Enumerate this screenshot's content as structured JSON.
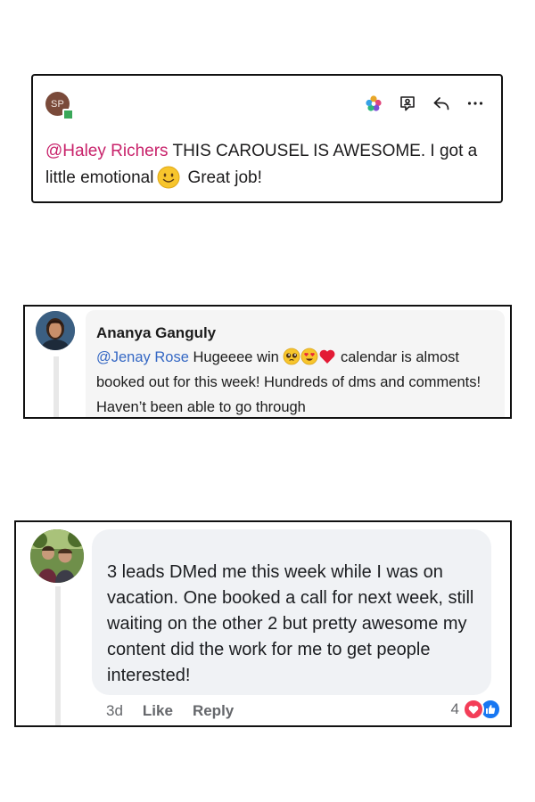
{
  "card1": {
    "avatar_initials": "SP",
    "mention": "@Haley Richers",
    "text_main": " THIS CAROUSEL IS AWESOME. I got a little emotional",
    "text_end": "Great job!",
    "actions": [
      "apps-icon",
      "assign-icon",
      "reply-icon",
      "more-icon"
    ],
    "mention_color": "#c8236b",
    "status_color": "#3aa859"
  },
  "card2": {
    "author": "Ananya Ganguly",
    "mention": "@Jenay Rose",
    "text_start": " Hugeeee win ",
    "text_rest": " calendar is almost booked out for this week! Hundreds of dms and comments! Haven’t been able to go through",
    "emojis": [
      "pleading-face-icon",
      "heart-eyes-icon",
      "red-heart-icon"
    ],
    "mention_color": "#3568c4"
  },
  "card3": {
    "text": "3 leads DMed me this week while I was on vacation. One booked a call for next week, still waiting on the other 2 but pretty awesome my content did the work for me to get people interested!",
    "time": "3d",
    "like_label": "Like",
    "reply_label": "Reply",
    "reaction_count": "4",
    "reactions": [
      "love-reaction-icon",
      "like-reaction-icon"
    ],
    "bubble_color": "#f0f2f5"
  }
}
